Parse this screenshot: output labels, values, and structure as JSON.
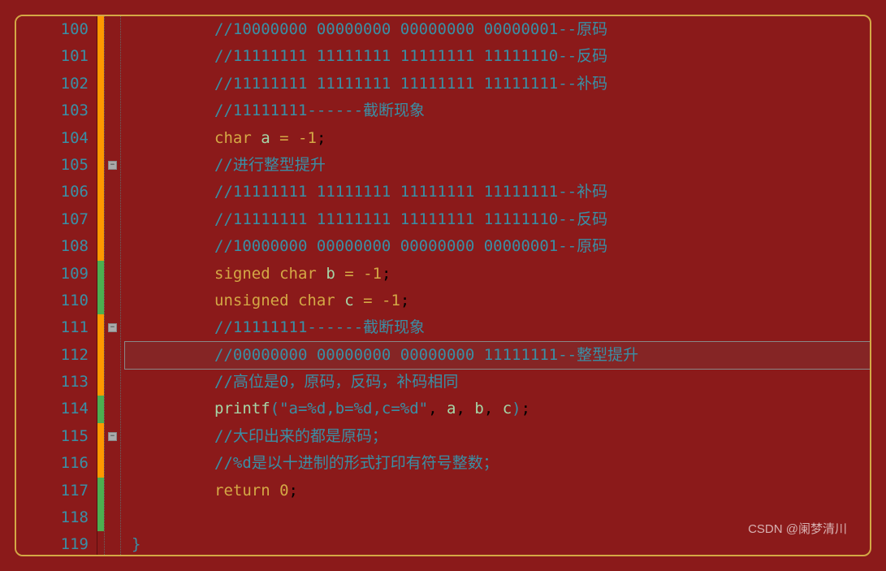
{
  "watermark": "CSDN @阑梦清川",
  "lines": [
    {
      "num": "100",
      "fold": "",
      "change": "orange",
      "type": "comment",
      "text": "//10000000 00000000 00000000 00000001--原码"
    },
    {
      "num": "101",
      "fold": "",
      "change": "orange",
      "type": "comment",
      "text": "//11111111 11111111 11111111 11111110--反码"
    },
    {
      "num": "102",
      "fold": "",
      "change": "orange",
      "type": "comment",
      "text": "//11111111 11111111 11111111 11111111--补码"
    },
    {
      "num": "103",
      "fold": "",
      "change": "orange",
      "type": "comment",
      "text": "//11111111------截断现象"
    },
    {
      "num": "104",
      "fold": "",
      "change": "orange",
      "type": "decl",
      "tokens": [
        {
          "t": "keyword",
          "v": "char"
        },
        {
          "t": "plain",
          "v": " "
        },
        {
          "t": "identifier",
          "v": "a"
        },
        {
          "t": "plain",
          "v": " "
        },
        {
          "t": "operator",
          "v": "="
        },
        {
          "t": "plain",
          "v": " "
        },
        {
          "t": "operator",
          "v": "-"
        },
        {
          "t": "number",
          "v": "1"
        },
        {
          "t": "plain",
          "v": ";"
        }
      ]
    },
    {
      "num": "105",
      "fold": "minus",
      "change": "orange",
      "type": "comment",
      "text": "//进行整型提升"
    },
    {
      "num": "106",
      "fold": "",
      "change": "orange",
      "type": "comment",
      "text": "//11111111 11111111 11111111 11111111--补码"
    },
    {
      "num": "107",
      "fold": "",
      "change": "orange",
      "type": "comment",
      "text": "//11111111 11111111 11111111 11111110--反码"
    },
    {
      "num": "108",
      "fold": "",
      "change": "orange",
      "type": "comment",
      "text": "//10000000 00000000 00000000 00000001--原码"
    },
    {
      "num": "109",
      "fold": "",
      "change": "green",
      "type": "decl",
      "tokens": [
        {
          "t": "keyword",
          "v": "signed"
        },
        {
          "t": "plain",
          "v": " "
        },
        {
          "t": "keyword",
          "v": "char"
        },
        {
          "t": "plain",
          "v": " "
        },
        {
          "t": "identifier",
          "v": "b"
        },
        {
          "t": "plain",
          "v": " "
        },
        {
          "t": "operator",
          "v": "="
        },
        {
          "t": "plain",
          "v": " "
        },
        {
          "t": "operator",
          "v": "-"
        },
        {
          "t": "number",
          "v": "1"
        },
        {
          "t": "plain",
          "v": ";"
        }
      ]
    },
    {
      "num": "110",
      "fold": "",
      "change": "green",
      "type": "decl",
      "tokens": [
        {
          "t": "keyword",
          "v": "unsigned"
        },
        {
          "t": "plain",
          "v": " "
        },
        {
          "t": "keyword",
          "v": "char"
        },
        {
          "t": "plain",
          "v": " "
        },
        {
          "t": "identifier",
          "v": "c"
        },
        {
          "t": "plain",
          "v": " "
        },
        {
          "t": "operator",
          "v": "="
        },
        {
          "t": "plain",
          "v": " "
        },
        {
          "t": "operator",
          "v": "-"
        },
        {
          "t": "number",
          "v": "1"
        },
        {
          "t": "plain",
          "v": ";"
        }
      ]
    },
    {
      "num": "111",
      "fold": "minus",
      "change": "orange",
      "type": "comment",
      "text": "//11111111------截断现象"
    },
    {
      "num": "112",
      "fold": "",
      "change": "orange",
      "type": "comment",
      "highlight": true,
      "text": "//00000000 00000000 00000000 11111111--整型提升"
    },
    {
      "num": "113",
      "fold": "",
      "change": "orange",
      "type": "comment",
      "text": "//高位是0，原码，反码，补码相同"
    },
    {
      "num": "114",
      "fold": "",
      "change": "green",
      "type": "call",
      "tokens": [
        {
          "t": "identifier",
          "v": "printf"
        },
        {
          "t": "paren",
          "v": "("
        },
        {
          "t": "string",
          "v": "\"a=%d,b=%d,c=%d\""
        },
        {
          "t": "plain",
          "v": ", "
        },
        {
          "t": "identifier",
          "v": "a"
        },
        {
          "t": "plain",
          "v": ", "
        },
        {
          "t": "identifier",
          "v": "b"
        },
        {
          "t": "plain",
          "v": ", "
        },
        {
          "t": "identifier",
          "v": "c"
        },
        {
          "t": "paren",
          "v": ")"
        },
        {
          "t": "plain",
          "v": ";"
        }
      ]
    },
    {
      "num": "115",
      "fold": "minus",
      "change": "orange",
      "type": "comment",
      "text": "//大印出来的都是原码；"
    },
    {
      "num": "116",
      "fold": "",
      "change": "orange",
      "type": "comment",
      "text": "//%d是以十进制的形式打印有符号整数；"
    },
    {
      "num": "117",
      "fold": "",
      "change": "green",
      "type": "ret",
      "tokens": [
        {
          "t": "keyword",
          "v": "return"
        },
        {
          "t": "plain",
          "v": " "
        },
        {
          "t": "number",
          "v": "0"
        },
        {
          "t": "plain",
          "v": ";"
        }
      ]
    },
    {
      "num": "118",
      "fold": "",
      "change": "green",
      "type": "blank",
      "text": ""
    },
    {
      "num": "119",
      "fold": "",
      "change": "",
      "type": "brace",
      "text": "}"
    }
  ],
  "fold_minus": "−"
}
